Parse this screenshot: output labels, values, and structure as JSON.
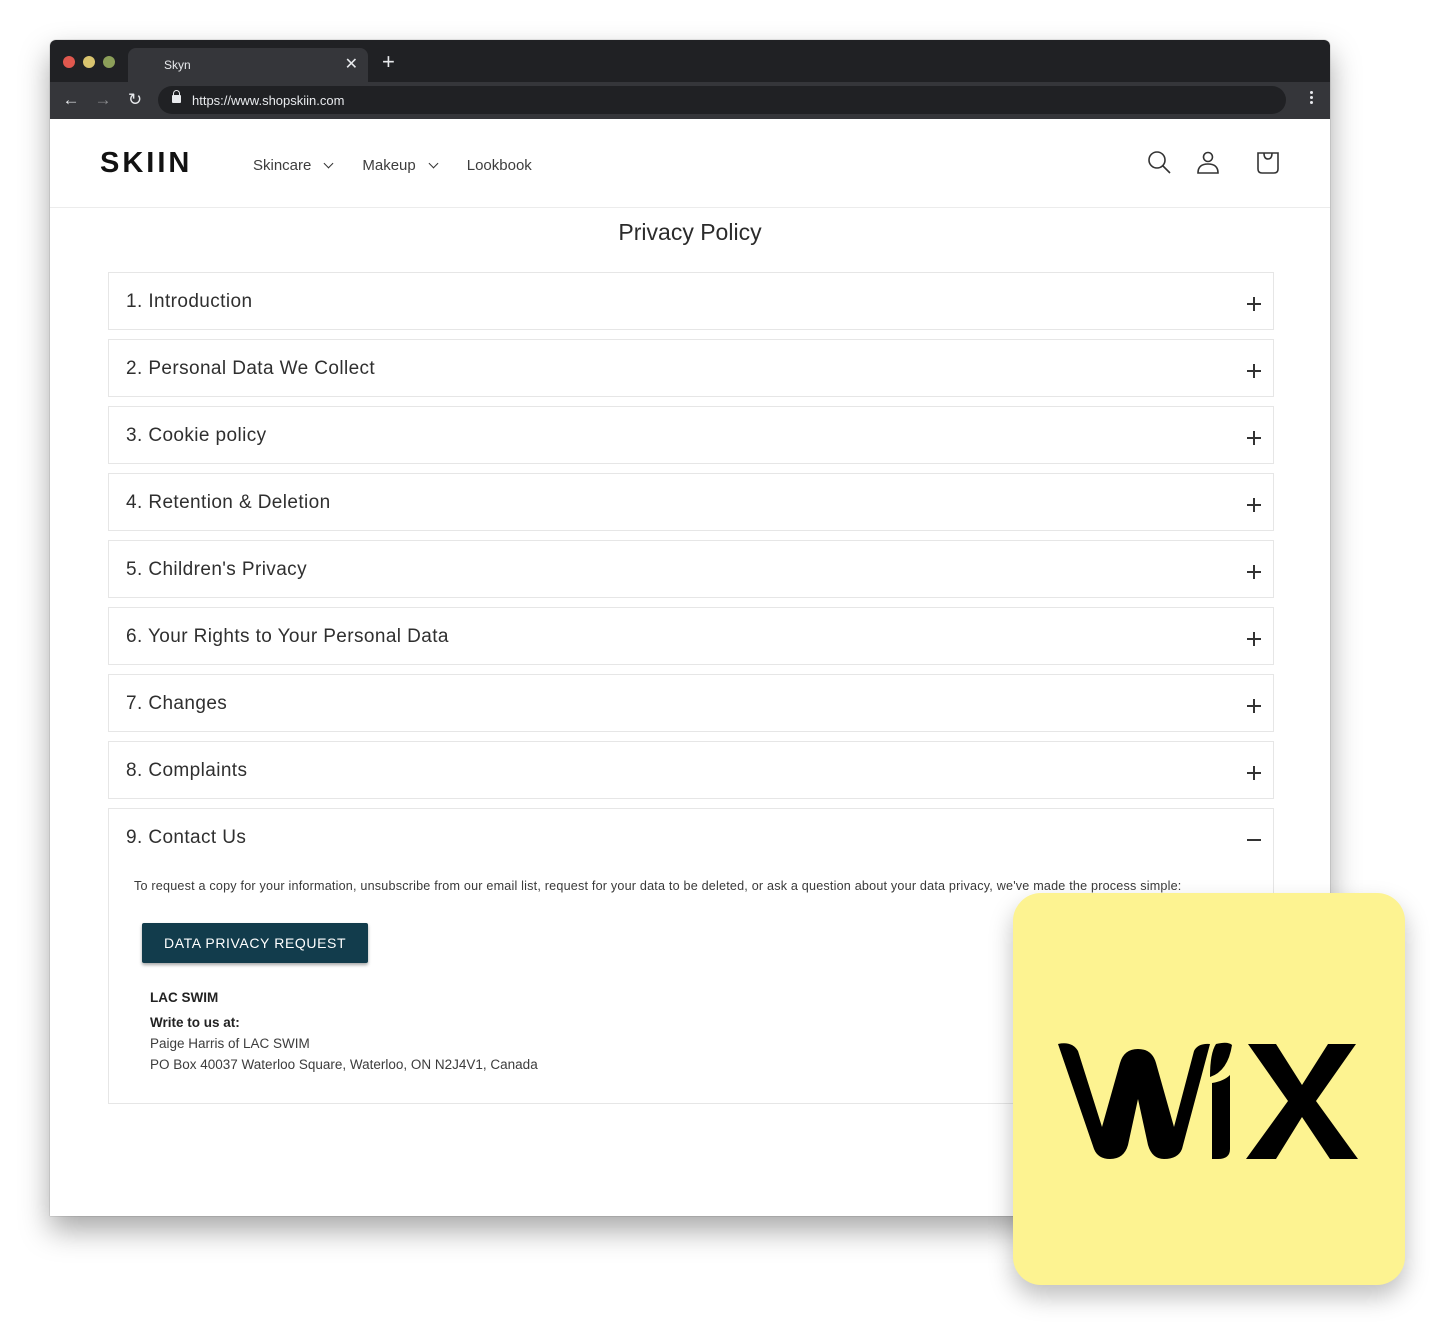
{
  "browser": {
    "tab_title": "Skyn",
    "url": "https://www.shopskiin.com",
    "icons": [
      "back-icon",
      "forward-icon",
      "reload-icon",
      "lock-icon",
      "close-icon",
      "new-tab-icon",
      "more-icon"
    ]
  },
  "site": {
    "logo": "SKIIN",
    "nav": [
      {
        "label": "Skincare",
        "has_dropdown": true
      },
      {
        "label": "Makeup",
        "has_dropdown": true
      },
      {
        "label": "Lookbook",
        "has_dropdown": false
      }
    ],
    "header_icons": [
      "search-icon",
      "account-icon",
      "cart-icon"
    ]
  },
  "page": {
    "title": "Privacy Policy",
    "sections": [
      {
        "title": "1. Introduction",
        "expanded": false
      },
      {
        "title": "2. Personal Data We Collect",
        "expanded": false
      },
      {
        "title": "3. Cookie policy",
        "expanded": false
      },
      {
        "title": "4. Retention & Deletion",
        "expanded": false
      },
      {
        "title": "5. Children's Privacy",
        "expanded": false
      },
      {
        "title": "6. Your Rights to Your Personal Data",
        "expanded": false
      },
      {
        "title": "7. Changes",
        "expanded": false
      },
      {
        "title": "8. Complaints",
        "expanded": false
      },
      {
        "title": "9. Contact Us",
        "expanded": true
      }
    ],
    "contact": {
      "intro": "To request a copy for your information, unsubscribe from our email list, request for your data to be deleted, or ask a question about your data privacy, we've made the process simple:",
      "button_label": "DATA PRIVACY REQUEST",
      "company": "LAC SWIM",
      "write_label": "Write to us at:",
      "name_line": "Paige Harris of LAC SWIM",
      "address_line": "PO Box 40037 Waterloo Square, Waterloo, ON N2J4V1, Canada"
    }
  },
  "overlay": {
    "brand": "WIX",
    "card_color": "#fdf391"
  }
}
